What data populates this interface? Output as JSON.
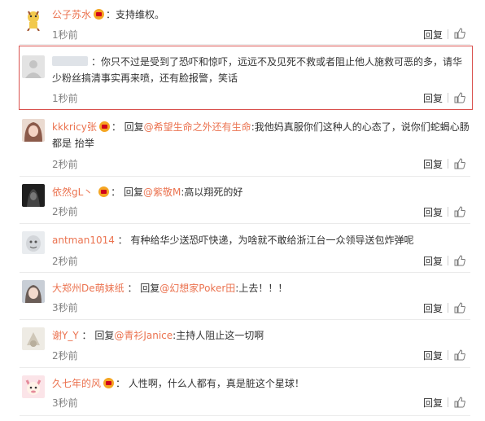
{
  "reply_label": "回复",
  "comments": [
    {
      "user": "公子苏水",
      "text": "支持维权。",
      "time": "1秒前",
      "avatar_color": "#f2c94c"
    },
    {
      "user": "",
      "text": "你只不过是受到了恐吓和惊吓，远远不及见死不救或者阻止他人施救可恶的多，请华少粉丝搞清事实再来喷，还有脸报警，笑话",
      "time": "1秒前",
      "avatar_color": "#d8d8d8"
    },
    {
      "user": "kkkricy张",
      "reply_prefix": "回复",
      "reply_to": "@希望生命之外还有生命",
      "text": ":我他妈真服你们这种人的心态了，说你们蛇蝎心肠都是 抬举",
      "time": "2秒前",
      "avatar_color": "#c9a38e"
    },
    {
      "user": "依然gL丶",
      "reply_prefix": "回复",
      "reply_to": "@紫敬M",
      "text": ":高以翔死的好",
      "time": "2秒前",
      "avatar_color": "#2b2b2b"
    },
    {
      "user": "antman1014",
      "text": "有种给华少送恐吓快递，为啥就不敢给浙江台一众领导送包炸弹呢",
      "time": "2秒前",
      "avatar_color": "#bfc4c9"
    },
    {
      "user": "大郑州De萌妹纸",
      "reply_prefix": "回复",
      "reply_to": "@幻想家Poker田",
      "text": ":上去！！！",
      "time": "3秒前",
      "avatar_color": "#9aa5b1"
    },
    {
      "user": "谢Y_Y",
      "reply_prefix": "回复",
      "reply_to": "@青衫Janice",
      "text": ":主持人阻止这一切啊",
      "time": "2秒前",
      "avatar_color": "#d6d0c4"
    },
    {
      "user": "久七年的风",
      "text": "人性啊，什么人都有，真是脏这个星球！",
      "time": "3秒前",
      "avatar_color": "#e8a0a8"
    }
  ]
}
